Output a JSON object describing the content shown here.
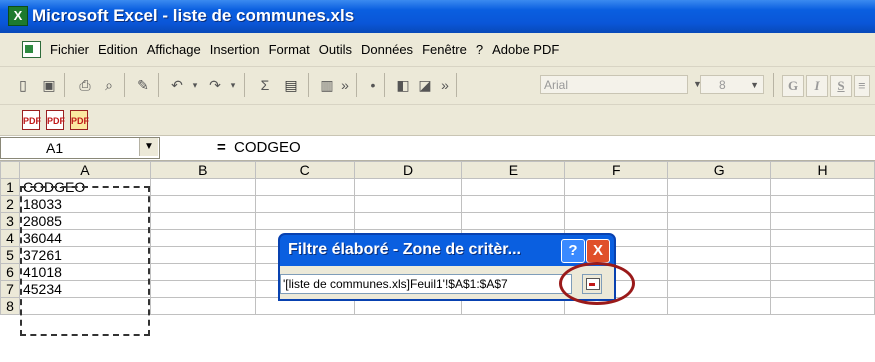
{
  "window": {
    "title": "Microsoft Excel - liste de communes.xls"
  },
  "menu": [
    "Fichier",
    "Edition",
    "Affichage",
    "Insertion",
    "Format",
    "Outils",
    "Données",
    "Fenêtre",
    "?",
    "Adobe PDF"
  ],
  "toolbar": {
    "font": "Arial",
    "size": "8"
  },
  "formula_bar": {
    "cell_ref": "A1",
    "equals": "=",
    "content": "CODGEO"
  },
  "grid": {
    "columns": [
      "A",
      "B",
      "C",
      "D",
      "E",
      "F",
      "G",
      "H"
    ],
    "rows": [
      "1",
      "2",
      "3",
      "4",
      "5",
      "6",
      "7",
      "8"
    ],
    "column_a": [
      "CODGEO",
      "18033",
      "28085",
      "36044",
      "37261",
      "41018",
      "45234",
      ""
    ]
  },
  "dialog": {
    "title": "Filtre élaboré - Zone de critèr...",
    "range": "'[liste de communes.xls]Feuil1'!$A$1:$A$7",
    "help": "?",
    "close": "X"
  },
  "colors": {
    "title_bar": "#0a5fe0",
    "highlight": "#9a1a1a"
  }
}
